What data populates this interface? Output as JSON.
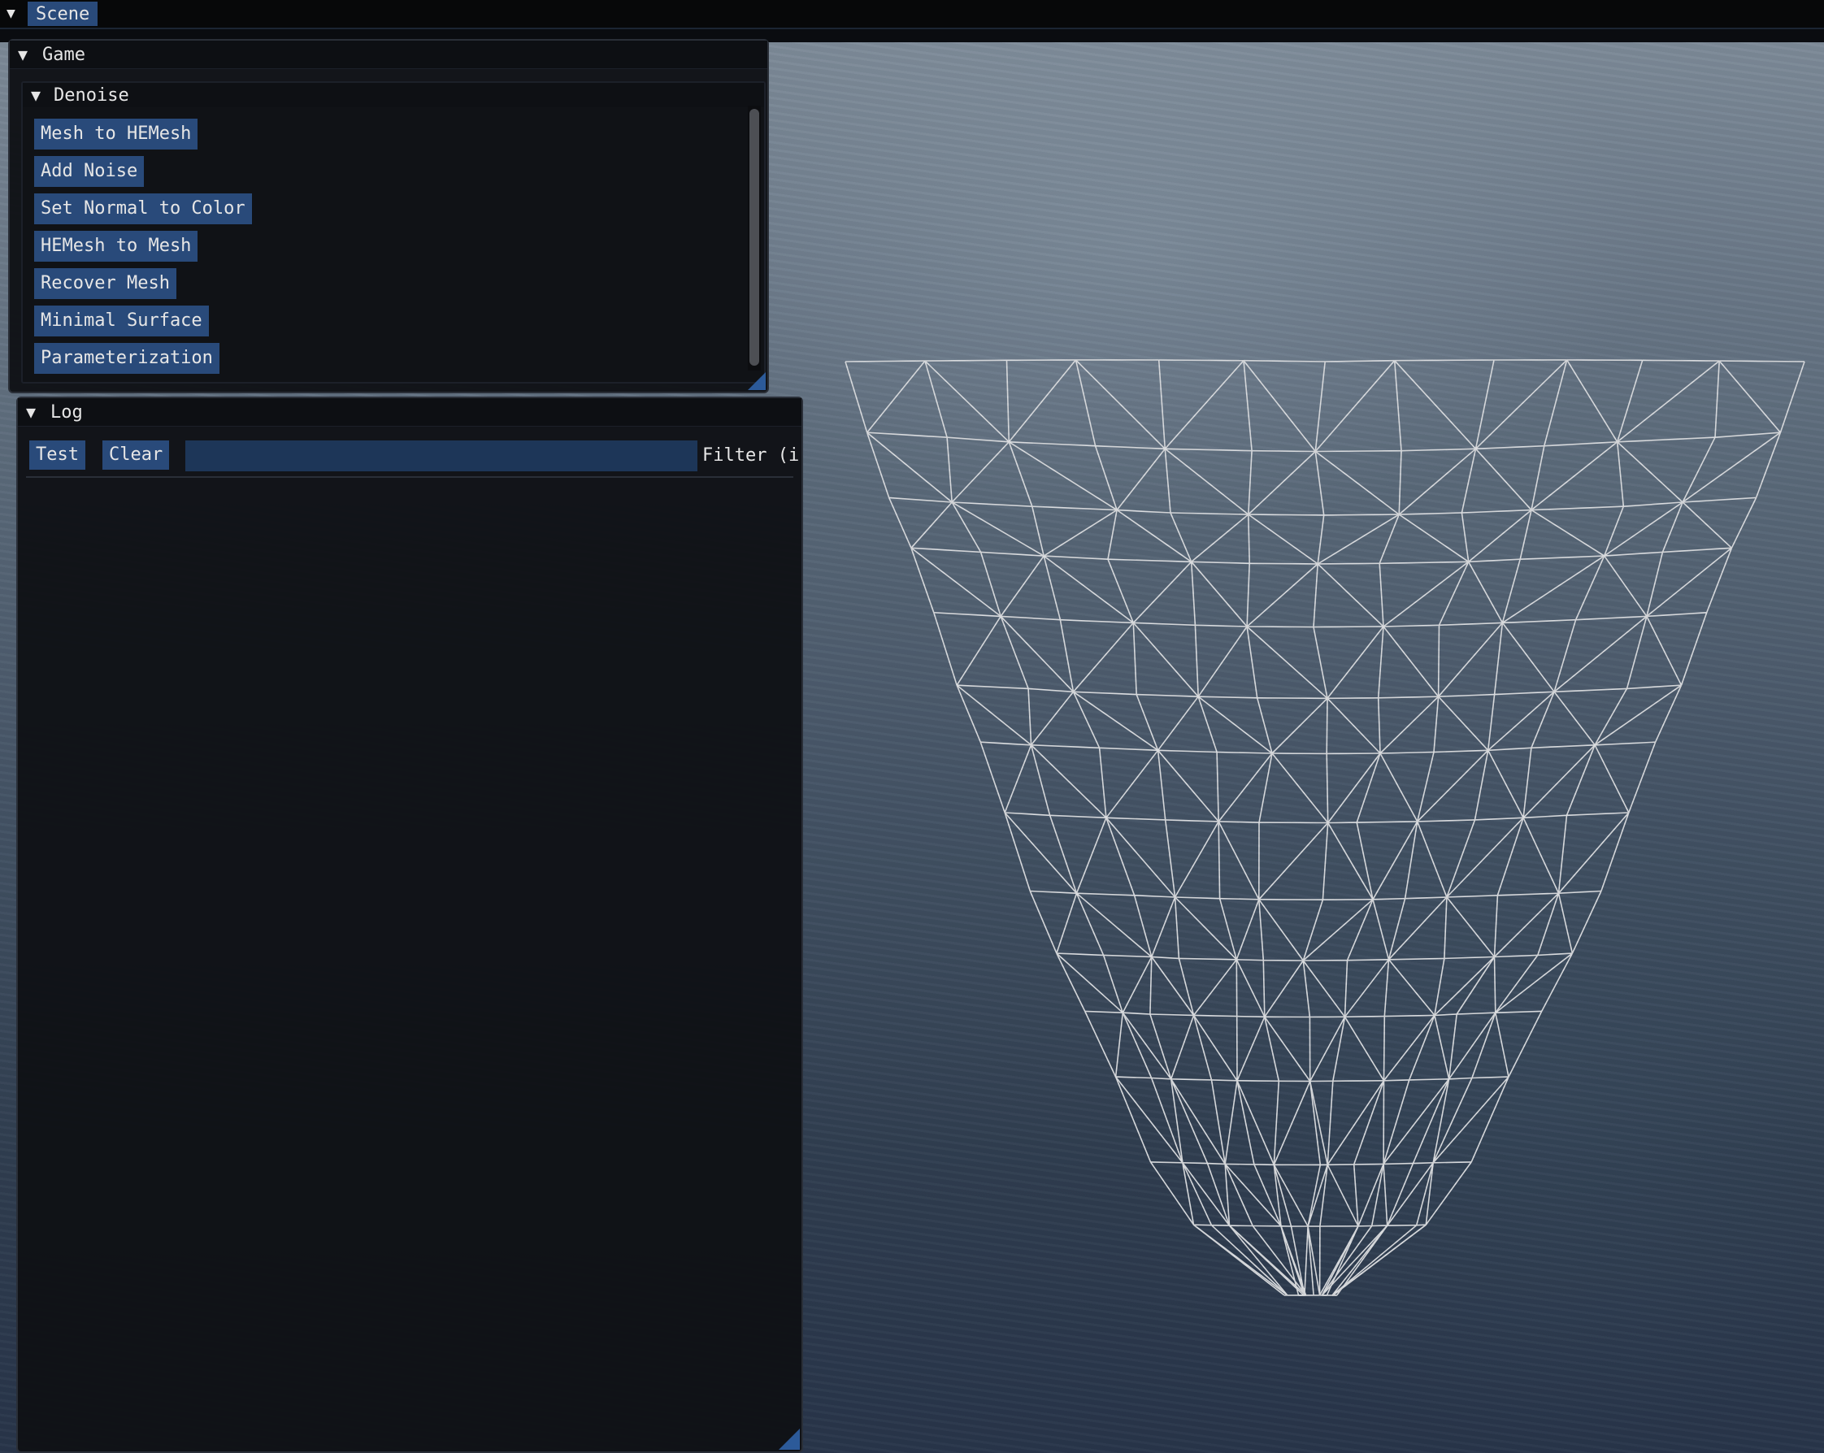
{
  "menubar": {
    "menu_icon": "triangle-down-icon",
    "tab_label": "Scene"
  },
  "game_window": {
    "title": "Game",
    "collapse_icon": "triangle-down-icon",
    "denoise": {
      "title": "Denoise",
      "buttons": [
        "Mesh to HEMesh",
        "Add Noise",
        "Set Normal to Color",
        "HEMesh to Mesh",
        "Recover Mesh",
        "Minimal Surface",
        "Parameterization"
      ]
    }
  },
  "log_window": {
    "title": "Log",
    "test_label": "Test",
    "clear_label": "Clear",
    "filter_value": "",
    "filter_label": "Filter (inc,-exc)"
  },
  "viewport": {
    "background": "ocean",
    "mesh_color": "#d9dbde",
    "render_mode": "wireframe"
  }
}
